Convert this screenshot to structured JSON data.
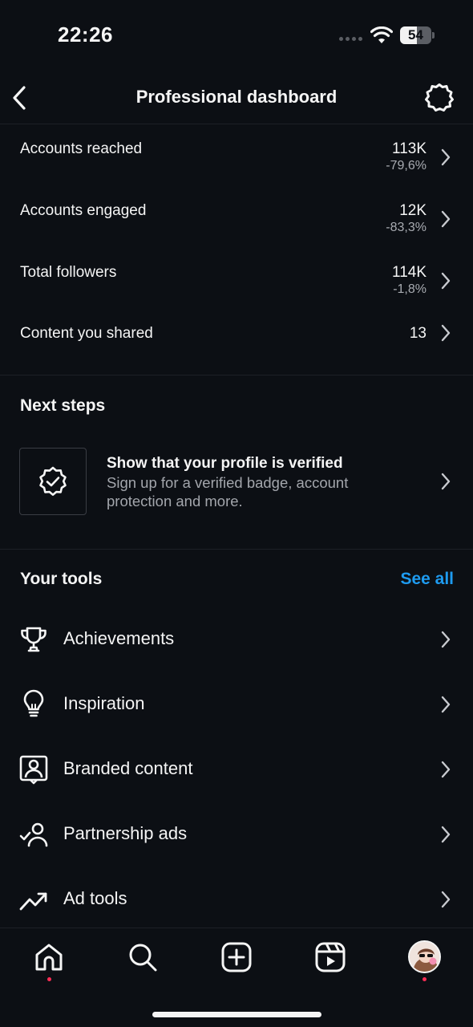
{
  "status_bar": {
    "time": "22:26",
    "battery_level": "54",
    "battery_fraction": 0.54
  },
  "header": {
    "title": "Professional dashboard",
    "back_icon": "chevron-left-icon",
    "settings_icon": "gear-icon"
  },
  "metrics": [
    {
      "label": "Accounts reached",
      "value": "113K",
      "change": "-79,6%"
    },
    {
      "label": "Accounts engaged",
      "value": "12K",
      "change": "-83,3%"
    },
    {
      "label": "Total followers",
      "value": "114K",
      "change": "-1,8%"
    },
    {
      "label": "Content you shared",
      "value": "13",
      "change": ""
    }
  ],
  "next_steps": {
    "title": "Next steps",
    "card": {
      "icon": "verified-badge-icon",
      "title": "Show that your profile is verified",
      "description": "Sign up for a verified badge, account protection and more."
    }
  },
  "tools": {
    "title": "Your tools",
    "see_all": "See all",
    "accent_color": "#1e9bf0",
    "items": [
      {
        "label": "Achievements",
        "icon": "trophy-icon"
      },
      {
        "label": "Inspiration",
        "icon": "lightbulb-icon"
      },
      {
        "label": "Branded content",
        "icon": "branded-content-icon"
      },
      {
        "label": "Partnership ads",
        "icon": "partnership-icon"
      },
      {
        "label": "Ad tools",
        "icon": "trending-up-icon"
      }
    ]
  },
  "bottom_nav": {
    "items": [
      "home-icon",
      "search-icon",
      "create-icon",
      "reels-icon",
      "profile-avatar"
    ],
    "notification_color": "#ff2d55"
  }
}
